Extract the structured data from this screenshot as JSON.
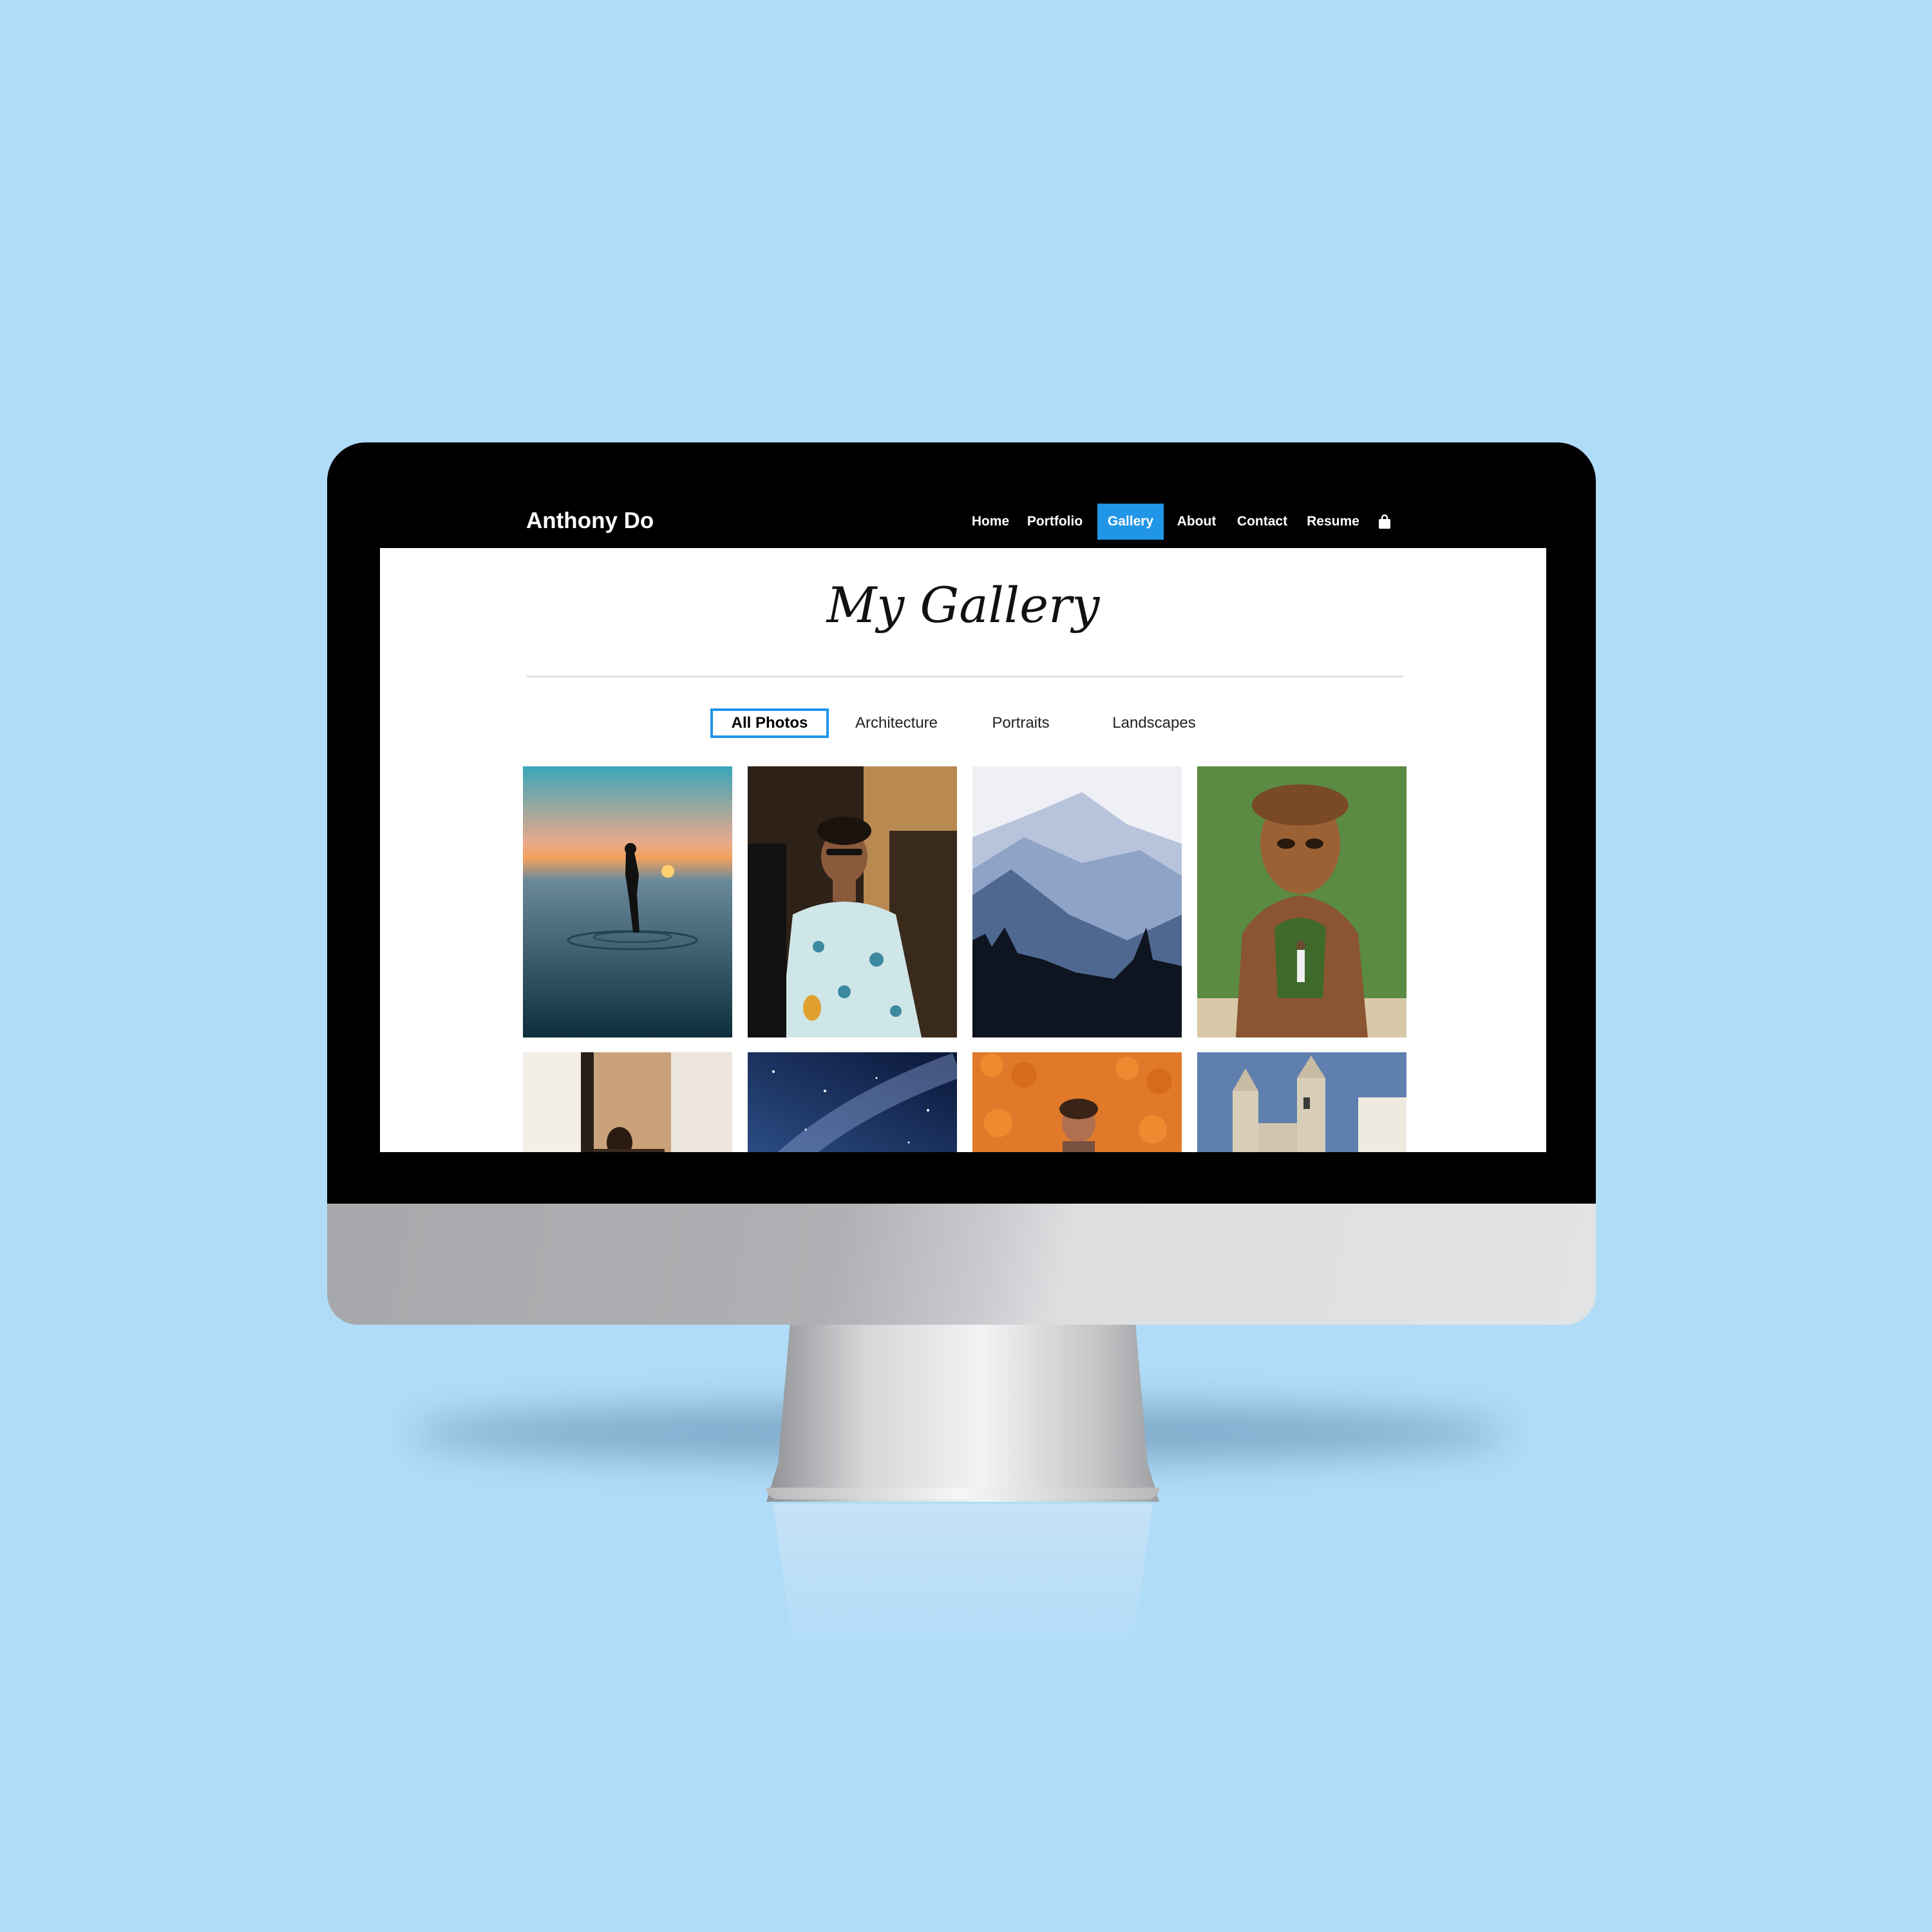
{
  "site": {
    "brand": "Anthony Do"
  },
  "nav": {
    "items": [
      {
        "label": "Home"
      },
      {
        "label": "Portfolio"
      },
      {
        "label": "Gallery",
        "active": true
      },
      {
        "label": "About"
      },
      {
        "label": "Contact"
      },
      {
        "label": "Resume"
      }
    ],
    "cart_icon": "shopping-bag-icon",
    "active_color": "#2196e8"
  },
  "gallery": {
    "title": "My Gallery",
    "filters": [
      {
        "label": "All Photos",
        "active": true
      },
      {
        "label": "Architecture"
      },
      {
        "label": "Portraits"
      },
      {
        "label": "Landscapes"
      }
    ]
  },
  "colors": {
    "background": "#b0dcf8",
    "navbar": "#000000",
    "accent": "#2196e8"
  }
}
